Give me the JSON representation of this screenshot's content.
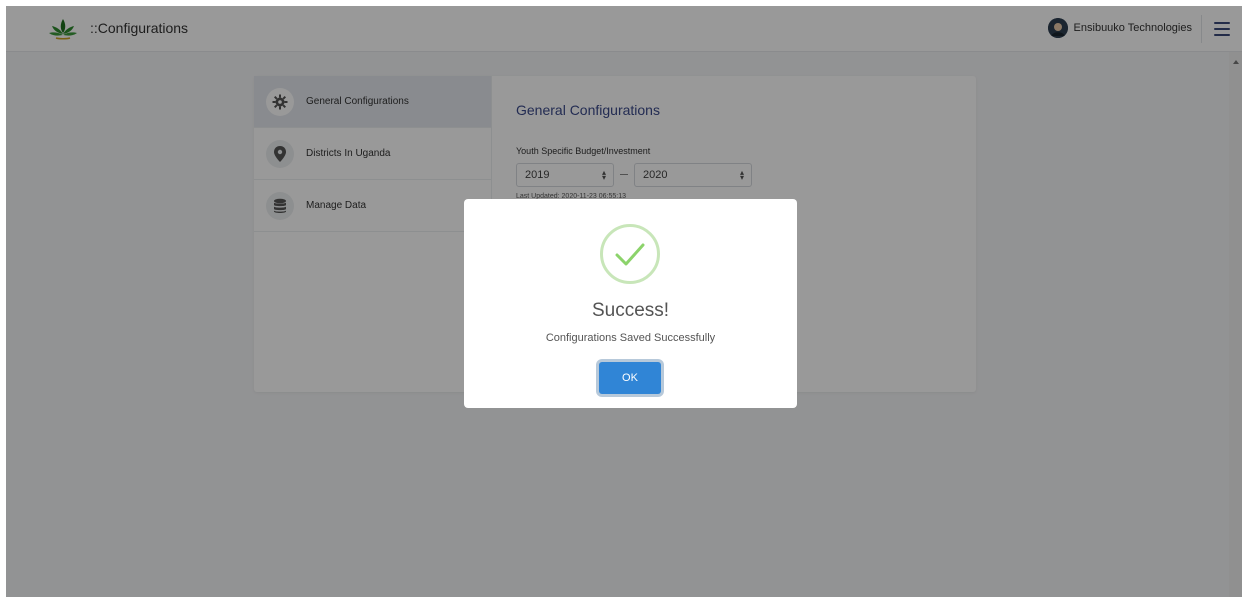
{
  "header": {
    "title": "::Configurations",
    "user_name": "Ensibuuko Technologies",
    "logo_icon": "leaf-logo-icon",
    "menu_icon": "hamburger-icon"
  },
  "sidebar": {
    "items": [
      {
        "label": "General Configurations",
        "icon": "gear-icon",
        "active": true
      },
      {
        "label": "Districts In Uganda",
        "icon": "map-pin-icon",
        "active": false
      },
      {
        "label": "Manage Data",
        "icon": "database-icon",
        "active": false
      }
    ]
  },
  "content": {
    "title": "General Configurations",
    "field_label": "Youth Specific Budget/Investment",
    "year_from": "2019",
    "year_to": "2020",
    "last_updated": "Last Updated: 2020-11-23 06:55:13"
  },
  "modal": {
    "title": "Success!",
    "message": "Configurations Saved Successfully",
    "ok_label": "OK",
    "icon": "success-check-icon"
  },
  "colors": {
    "accent": "#3b4a8a",
    "ok_button": "#3085d6",
    "success_check": "#8cd36b",
    "logo_green": "#2e8b2e"
  }
}
